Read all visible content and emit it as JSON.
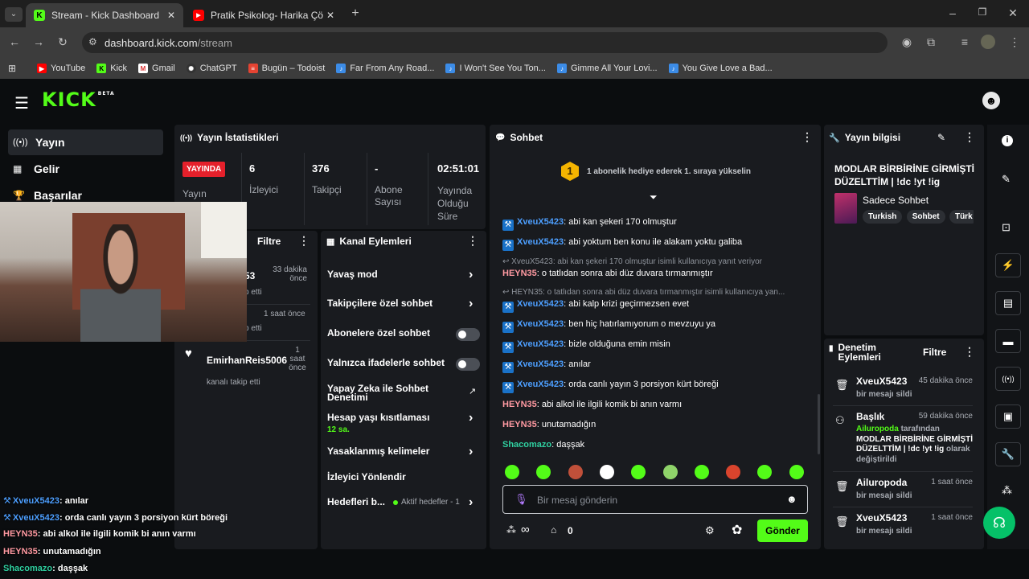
{
  "browser": {
    "tabs": [
      {
        "title": "Stream - Kick Dashboard"
      },
      {
        "title": "Pratik Psikolog- Harika Çözüm"
      }
    ],
    "url_host": "dashboard.kick.com",
    "url_path": "/stream",
    "bookmarks": [
      "YouTube",
      "Kick",
      "Gmail",
      "ChatGPT",
      "Bugün – Todoist",
      "Far From Any Road...",
      "I Won't See You Ton...",
      "Gimme All Your Lovi...",
      "You Give Love a Bad..."
    ]
  },
  "app": {
    "logo": "KICK",
    "logo_badge": "BETA",
    "nav": [
      "Yayın",
      "Gelir",
      "Başarılar"
    ]
  },
  "stats": {
    "title": "Yayın İstatistikleri",
    "live_badge": "YAYINDA",
    "live_label": "Yayın",
    "items": [
      {
        "value": "6",
        "label": "İzleyici"
      },
      {
        "value": "376",
        "label": "Takipçi"
      },
      {
        "value": "-",
        "label": "Abone Sayısı"
      },
      {
        "value": "02:51:01",
        "label": "Yayında Olduğu Süre"
      }
    ]
  },
  "activity": {
    "filter": "Filtre",
    "rows": [
      {
        "time": "33 dakika önce",
        "frag": "53",
        "sub": "p etti"
      },
      {
        "time": "1 saat önce",
        "sub": "p etti"
      },
      {
        "user": "EmirhanReis5006",
        "time": "1 saat önce",
        "sub": "kanalı takip etti"
      }
    ]
  },
  "channel_actions": {
    "title": "Kanal Eylemleri",
    "items": [
      {
        "label": "Yavaş mod",
        "kind": "chevron"
      },
      {
        "label": "Takipçilere özel sohbet",
        "kind": "chevron"
      },
      {
        "label": "Abonelere özel sohbet",
        "kind": "toggle"
      },
      {
        "label": "Yalnızca ifadelerle sohbet",
        "kind": "toggle"
      },
      {
        "label": "Yapay Zeka ile Sohbet Denetimi",
        "kind": "external"
      },
      {
        "label": "Hesap yaşı kısıtlaması",
        "sub": "12 sa.",
        "kind": "chevron"
      },
      {
        "label": "Yasaklanmış kelimeler",
        "kind": "chevron"
      },
      {
        "label": "İzleyici Yönlendir",
        "kind": "none"
      },
      {
        "label": "Hedefleri b...",
        "badge": "Aktif hedefler - 1",
        "kind": "chevron"
      }
    ]
  },
  "chat": {
    "title": "Sohbet",
    "pinned_rank": "1",
    "pinned_text": "1 abonelik hediye ederek 1. sıraya yükselin",
    "messages": [
      {
        "user": "XveuX5423",
        "text": "abi kan şekeri 170 olmuştur",
        "color": "#4d9fff",
        "badge": true
      },
      {
        "user": "XveuX5423",
        "text": "abi yoktum ben konu ile alakam yoktu galiba",
        "color": "#4d9fff",
        "badge": true
      },
      {
        "reply": "XveuX5423: abi kan şekeri 170 olmuştur isimli kullanıcıya yanıt veriyor"
      },
      {
        "user": "HEYN35",
        "text": "o tatlıdan sonra abi düz duvara tırmanmıştır",
        "color": "#ff9aa2",
        "badge": false
      },
      {
        "reply": "HEYN35: o tatlıdan sonra abi düz duvara tırmanmıştır isimli kullanıcıya yan..."
      },
      {
        "user": "XveuX5423",
        "text": "abi kalp krizi geçirmezsen evet",
        "color": "#4d9fff",
        "badge": true
      },
      {
        "user": "XveuX5423",
        "text": "ben hiç hatırlamıyorum o mevzuyu ya",
        "color": "#4d9fff",
        "badge": true
      },
      {
        "user": "XveuX5423",
        "text": "bizle olduğuna emin misin",
        "color": "#4d9fff",
        "badge": true
      },
      {
        "user": "XveuX5423",
        "text": "anılar",
        "color": "#4d9fff",
        "badge": true
      },
      {
        "user": "XveuX5423",
        "text": "orda canlı yayın 3 porsiyon kürt böreği",
        "color": "#4d9fff",
        "badge": true
      },
      {
        "user": "HEYN35",
        "text": "abi alkol ile ilgili komik bi anın varmı",
        "color": "#ff9aa2",
        "badge": false
      },
      {
        "user": "HEYN35",
        "text": "unutamadığın",
        "color": "#ff9aa2",
        "badge": false
      },
      {
        "user": "Shacomazo",
        "text": "daşşak",
        "color": "#2fd0a0",
        "badge": false
      }
    ],
    "input_placeholder": "Bir mesaj gönderin",
    "points": "∞",
    "count": "0",
    "send": "Gönder"
  },
  "stream_info": {
    "title": "Yayın bilgisi",
    "stream_title": "MODLAR BİRBİRİNE GİRMİŞTİ DÜZELTTİM | !dc !yt !ig",
    "category": "Sadece Sohbet",
    "tags": [
      "Turkish",
      "Sohbet",
      "Türk"
    ]
  },
  "moderation": {
    "title": "Denetim Eylemleri",
    "filter": "Filtre",
    "items": [
      {
        "user": "XveuX5423",
        "time": "45 dakika önce",
        "desc": "bir mesajı sildi"
      },
      {
        "user": "Başlık",
        "time": "59 dakika önce",
        "by": "Ailuropoda",
        "by_suffix": "tarafından",
        "value": "MODLAR BİRBİRİNE GİRMİŞTİ DÜZELTTİM | !dc !yt !ig",
        "suffix": "olarak değiştirildi"
      },
      {
        "user": "Ailuropoda",
        "time": "1 saat önce",
        "desc": "bir mesajı sildi"
      },
      {
        "user": "XveuX5423",
        "time": "1 saat önce",
        "desc": "bir mesajı sildi"
      }
    ]
  },
  "overlay_chat": [
    {
      "user": "XveuX5423",
      "text": "anılar",
      "color": "#4d9fff"
    },
    {
      "user": "XveuX5423",
      "text": "orda canlı yayın 3 porsiyon kürt böreği",
      "color": "#4d9fff"
    },
    {
      "user": "HEYN35",
      "text": "abi alkol ile ilgili komik bi anın varmı",
      "color": "#ff9aa2"
    },
    {
      "user": "HEYN35",
      "text": "unutamadığın",
      "color": "#ff9aa2"
    },
    {
      "user": "Shacomazo",
      "text": "daşşak",
      "color": "#2fd0a0"
    }
  ],
  "colors": {
    "accent": "#53fc18",
    "live": "#e5202b"
  }
}
